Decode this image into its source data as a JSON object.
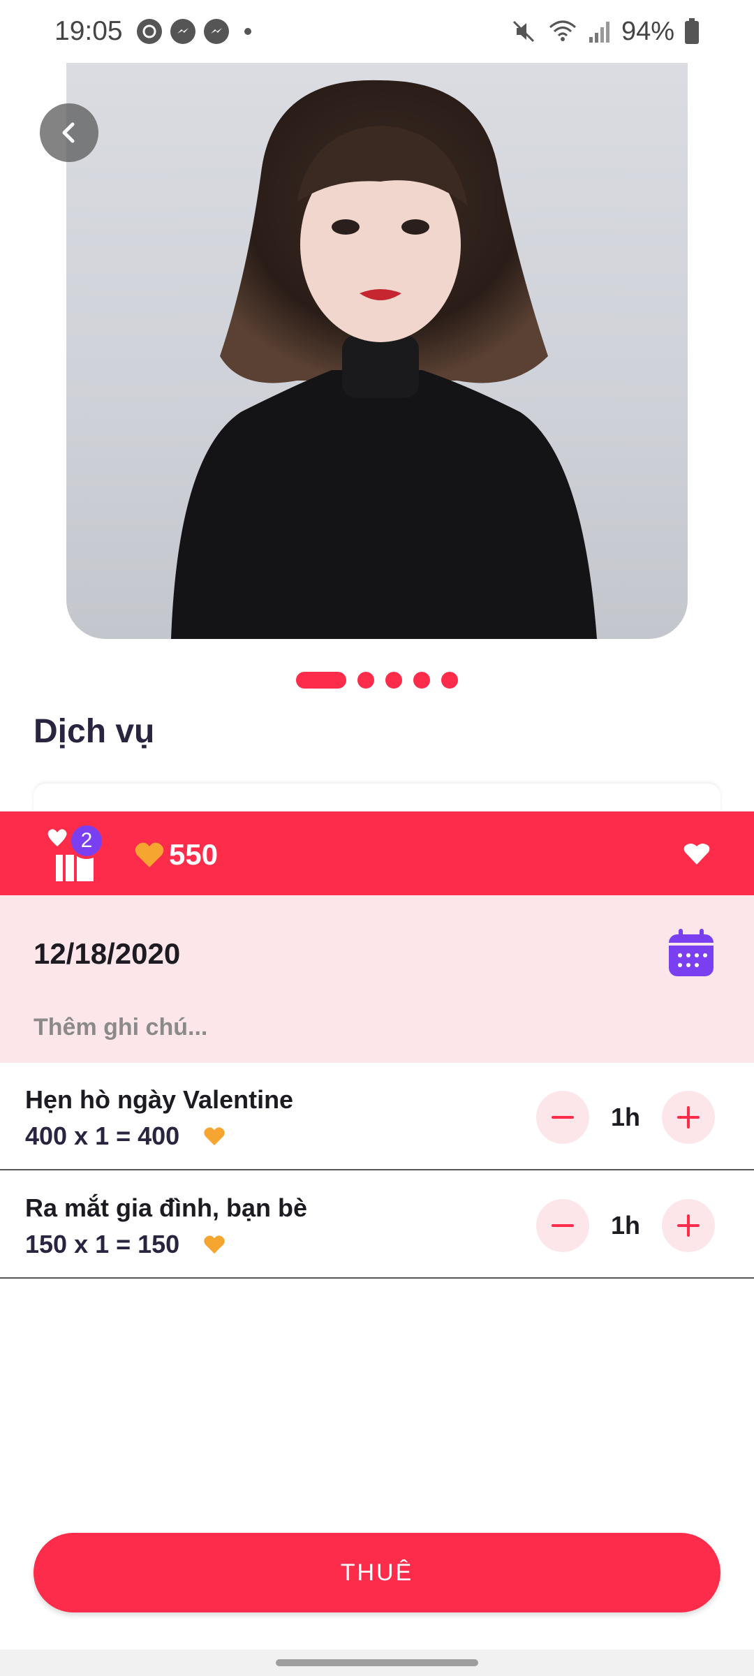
{
  "status_bar": {
    "time": "19:05",
    "battery": "94%"
  },
  "section": {
    "title": "Dịch vụ"
  },
  "wallet": {
    "gift_count": "2",
    "coins": "550"
  },
  "booking": {
    "date": "12/18/2020",
    "note_placeholder": "Thêm ghi chú..."
  },
  "services": [
    {
      "name": "Hẹn hò ngày Valentine",
      "calc": "400 x 1 = 400",
      "qty": "1h"
    },
    {
      "name": "Ra mắt gia đình, bạn bè",
      "calc": "150 x 1 = 150",
      "qty": "1h"
    }
  ],
  "actions": {
    "hire_label": "THUÊ"
  },
  "colors": {
    "primary": "#fc2c4a",
    "pink_bg": "#fde6ea",
    "purple": "#7b3ff2",
    "coin": "#f7a531",
    "title": "#2a2440"
  },
  "pager": {
    "count": 5,
    "active_index": 0
  }
}
